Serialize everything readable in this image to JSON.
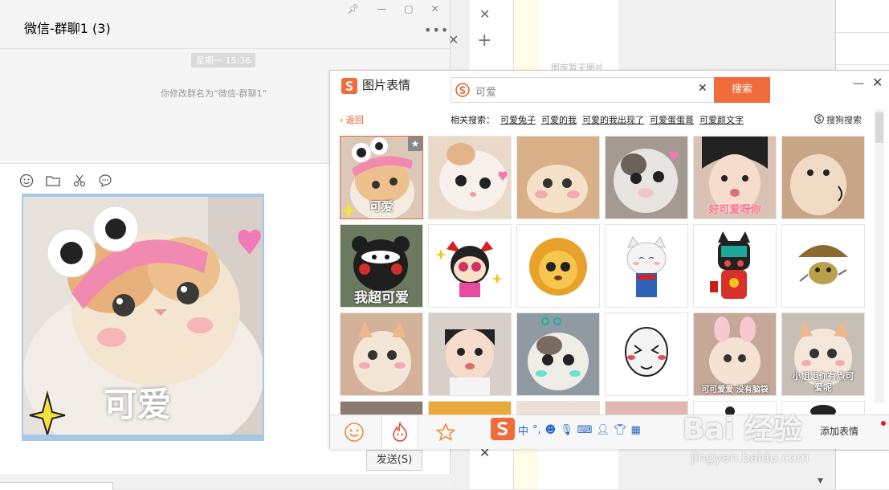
{
  "colors": {
    "accent": "#f26b3a",
    "link": "#2a67c8",
    "selection": "#a6c8e8"
  },
  "background_app": {
    "empty_text": "图库暂无图片"
  },
  "wechat": {
    "title": "微信-群聊1 (3)",
    "more_icon": "more-icon",
    "time_label": "星期一 15:36",
    "system_message": "你修改群名为“微信-群聊1”",
    "toolbar_icons": [
      "emoji-icon",
      "folder-icon",
      "scissors-icon",
      "chat-bubble-icon"
    ],
    "image_caption": "可爱",
    "send_label": "发送(S)"
  },
  "panel": {
    "title": "图片表情",
    "search_value": "可爱",
    "search_button": "搜索",
    "back_label": "返回",
    "related_label": "相关搜索：",
    "related": [
      "可爱兔子",
      "可爱的我",
      "可爱的我出现了",
      "可爱蛋蛋哥",
      "可爱颜文字"
    ],
    "sogou_label": "搜狗搜索",
    "stickers": [
      {
        "caption": "可爱",
        "bg": "#dcc8b8"
      },
      {
        "caption": "",
        "bg": "#ead8c8"
      },
      {
        "caption": "",
        "bg": "#d9b087"
      },
      {
        "caption": "",
        "bg": "#a49a92"
      },
      {
        "caption": "好可爱呀你",
        "bg": "#d9c2b3"
      },
      {
        "caption": "",
        "bg": "#c8a585"
      },
      {
        "caption": "我超可爱",
        "bg": "#6b7a5e"
      },
      {
        "caption": "",
        "bg": "#ffffff"
      },
      {
        "caption": "",
        "bg": "#ffffff"
      },
      {
        "caption": "",
        "bg": "#ffffff"
      },
      {
        "caption": "",
        "bg": "#ffffff"
      },
      {
        "caption": "",
        "bg": "#ffffff"
      },
      {
        "caption": "",
        "bg": "#d4b29a"
      },
      {
        "caption": "",
        "bg": "#d8cfc9"
      },
      {
        "caption": "",
        "bg": "#8f9aa3"
      },
      {
        "caption": "",
        "bg": "#ffffff"
      },
      {
        "caption": "可可爱爱 没有脑袋",
        "bg": "#c5a898"
      },
      {
        "caption": "小姐姐你有点可爱呢",
        "bg": "#c7bfb6"
      },
      {
        "caption": "",
        "bg": "#8a7a70"
      },
      {
        "caption": "",
        "bg": "#e8a83a"
      },
      {
        "caption": "",
        "bg": "#ece0d8"
      },
      {
        "caption": "",
        "bg": "#e0b8b0"
      },
      {
        "caption": "",
        "bg": "#ffffff"
      },
      {
        "caption": "",
        "bg": "#ffffff"
      }
    ],
    "tab_icons": [
      "smile-tab-icon",
      "hot-tab-icon",
      "star-tab-icon"
    ],
    "ime_chars": [
      "中",
      "°,"
    ],
    "add_label": "添加表情"
  },
  "watermark": {
    "brand": "Bai 经验",
    "url": "jingyan.baidu.com"
  }
}
